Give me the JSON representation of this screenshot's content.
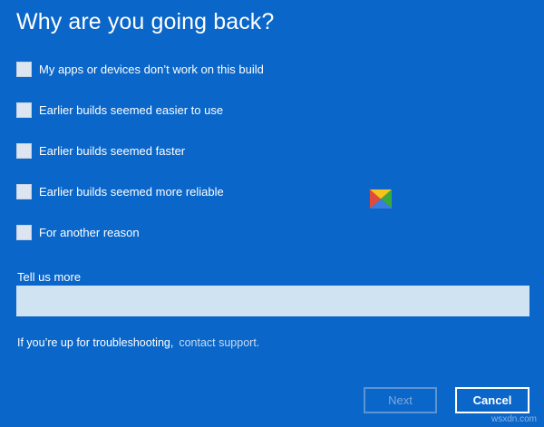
{
  "dialog": {
    "title": "Why are you going back?"
  },
  "options": [
    {
      "label": "My apps or devices don’t work on this build",
      "checked": false
    },
    {
      "label": "Earlier builds seemed easier to use",
      "checked": false
    },
    {
      "label": "Earlier builds seemed faster",
      "checked": false
    },
    {
      "label": "Earlier builds seemed more reliable",
      "checked": false
    },
    {
      "label": "For another reason",
      "checked": false
    }
  ],
  "tell_more": {
    "label": "Tell us more",
    "value": ""
  },
  "troubleshoot": {
    "text": "If you’re up for troubleshooting,",
    "link": "contact support."
  },
  "buttons": {
    "next": "Next",
    "cancel": "Cancel"
  },
  "watermark": "wsxdn.com",
  "colors": {
    "background": "#0a66c8",
    "input_fill": "#cfe3f3",
    "checkbox_fill": "#dde6f0",
    "link": "#c8dcf4",
    "disabled_button": "#5d94d4"
  }
}
